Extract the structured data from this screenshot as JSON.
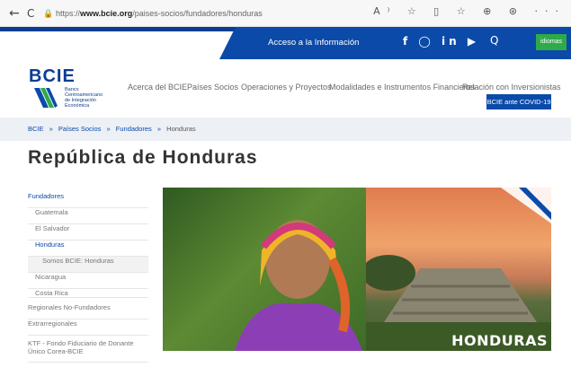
{
  "browser": {
    "back": "←",
    "refresh": "C",
    "lock": "🔒",
    "url_prefix": "https://",
    "url_domain": "www.bcie.org",
    "url_path": "/paises-socios/fundadores/honduras",
    "icons": "A⁾ ☆ ▯ ☆ ⊕ ⊛ ···"
  },
  "topbar": {
    "access_label": "Acceso a la Información",
    "social_icons": [
      "facebook-icon",
      "twitter-icon",
      "instagram-icon",
      "linkedin-icon",
      "youtube-icon"
    ],
    "social_glyphs": "f  ◯ in ▶",
    "search_glyph": "Q",
    "language_label": "idiomas"
  },
  "logo": {
    "word": "BCIE",
    "subtitle_lines": [
      "Banco",
      "Centroamericano",
      "de Integración",
      "Económica"
    ]
  },
  "menu": {
    "items": [
      "Acerca del BCIE",
      "Países Socios",
      "Operaciones y Proyectos",
      "Modalidades e Instrumentos Financieros",
      "Relación con Inversionistas"
    ],
    "covid_label": "BCIE ante COVID-19"
  },
  "breadcrumb": {
    "items": [
      "BCIE",
      "»",
      "Países Socios",
      "»",
      "Fundadores",
      "»",
      "Honduras"
    ]
  },
  "page_title": "República de Honduras",
  "sidebar": {
    "items": [
      "Fundadores",
      "Guatemala",
      "El Salvador",
      "Honduras",
      "Somos BCIE: Honduras",
      "Nicaragua",
      "Costa Rica",
      "Regionales No-Fundadores",
      "Extrarregionales",
      "KTF - Fondo Fiduciario de Donante Único Corea-BCIE"
    ]
  },
  "hero": {
    "label": "HONDURAS"
  },
  "colors": {
    "brand_blue": "#0b4aa8",
    "language_green": "#2eaa4a"
  }
}
